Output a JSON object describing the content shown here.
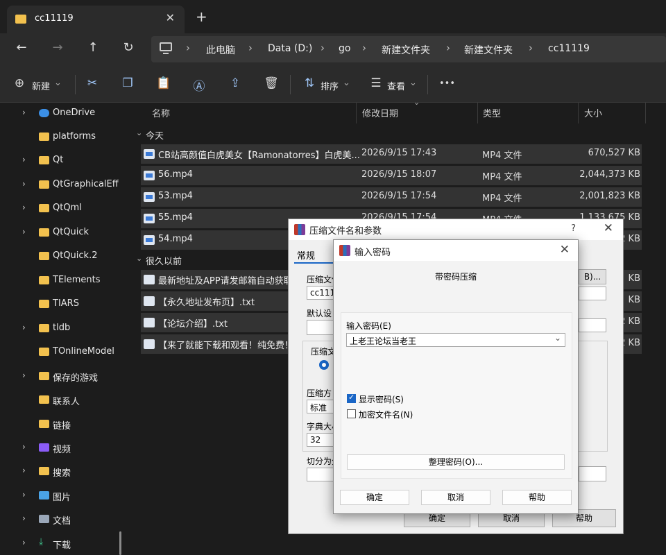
{
  "window": {
    "tab_title": "cc11119",
    "close_glyph": "✕",
    "new_tab_glyph": "+"
  },
  "address": {
    "crumbs": [
      "此电脑",
      "Data (D:)",
      "go",
      "新建文件夹",
      "新建文件夹",
      "cc11119"
    ],
    "separator": "›"
  },
  "nav": {
    "back": "←",
    "forward": "→",
    "up": "↑",
    "refresh": "↻"
  },
  "toolbar": {
    "new_label": "新建",
    "sort_label": "排序",
    "view_label": "查看",
    "more_glyph": "•••",
    "dropdown_glyph": "⌄"
  },
  "sidebar": {
    "items": [
      {
        "label": "OneDrive",
        "chevron": "›"
      },
      {
        "label": "platforms",
        "chevron": ""
      },
      {
        "label": "Qt",
        "chevron": "›"
      },
      {
        "label": "QtGraphicalEff",
        "chevron": "›"
      },
      {
        "label": "QtQml",
        "chevron": "›"
      },
      {
        "label": "QtQuick",
        "chevron": "›"
      },
      {
        "label": "QtQuick.2",
        "chevron": ""
      },
      {
        "label": "TElements",
        "chevron": ""
      },
      {
        "label": "TIARS",
        "chevron": ""
      },
      {
        "label": "tldb",
        "chevron": "›"
      },
      {
        "label": "TOnlineModel",
        "chevron": ""
      },
      {
        "label": "保存的游戏",
        "chevron": "›"
      },
      {
        "label": "联系人",
        "chevron": ""
      },
      {
        "label": "链接",
        "chevron": ""
      },
      {
        "label": "视频",
        "chevron": "›"
      },
      {
        "label": "搜索",
        "chevron": "›"
      },
      {
        "label": "图片",
        "chevron": "›"
      },
      {
        "label": "文档",
        "chevron": "›"
      },
      {
        "label": "下载",
        "chevron": "›"
      }
    ]
  },
  "columns": {
    "name": "名称",
    "date": "修改日期",
    "type": "类型",
    "size": "大小"
  },
  "groups": {
    "today": "今天",
    "long_ago": "很久以前",
    "group_chevron": "⌄"
  },
  "files_today": [
    {
      "name": "CB站高颜值白虎美女【Ramonatorres】白虎美...",
      "date": "2026/9/15 17:43",
      "type": "MP4 文件",
      "size": "670,527 KB"
    },
    {
      "name": "56.mp4",
      "date": "2026/9/15 18:07",
      "type": "MP4 文件",
      "size": "2,044,373 KB"
    },
    {
      "name": "53.mp4",
      "date": "2026/9/15 17:54",
      "type": "MP4 文件",
      "size": "2,001,823 KB"
    },
    {
      "name": "55.mp4",
      "date": "2026/9/15 17:54",
      "type": "MP4 文件",
      "size": "1,133,675 KB"
    },
    {
      "name": "54.mp4",
      "date": "",
      "type": "",
      "size": "2 KB"
    }
  ],
  "files_old": [
    {
      "name": "最新地址及APP请发邮箱自动获取",
      "size": "KB"
    },
    {
      "name": "【永久地址发布页】.txt",
      "size": "KB"
    },
    {
      "name": "【论坛介绍】.txt",
      "size": "2 KB"
    },
    {
      "name": "【来了就能下载和观看！纯免费！",
      "size": "2 KB"
    }
  ],
  "dialog_back": {
    "title": "压缩文件名和参数",
    "help_glyph": "?",
    "close_glyph": "✕",
    "tab_general": "常规",
    "archive_name_label": "压缩文件",
    "archive_name_value": "cc1111",
    "browse_button": "B)...",
    "default_label": "默认设",
    "format_label": "压缩文",
    "method_label": "压缩方",
    "method_value": "标准",
    "dict_label": "字典大小",
    "dict_value": "32",
    "split_label": "切分为分",
    "ok": "确定",
    "cancel": "取消",
    "help": "帮助"
  },
  "dialog_pwd": {
    "title": "输入密码",
    "close_glyph": "✕",
    "heading": "带密码压缩",
    "enter_label": "输入密码(E)",
    "password_value": "上老王论坛当老王",
    "dropdown_glyph": "⌄",
    "show_password_label": "显示密码(S)",
    "show_password_checked": true,
    "encrypt_names_label": "加密文件名(N)",
    "encrypt_names_checked": false,
    "organize_button": "整理密码(O)...",
    "ok": "确定",
    "cancel": "取消",
    "help": "帮助"
  },
  "colors": {
    "accent": "#3b7ad6",
    "folder": "#f2c14e",
    "row_bg": "#333333"
  }
}
